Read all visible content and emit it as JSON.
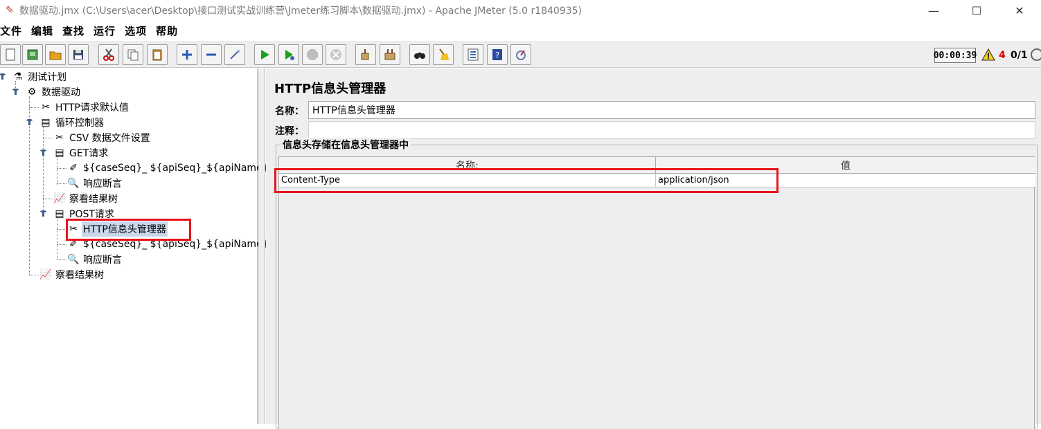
{
  "window": {
    "title": "数据驱动.jmx (C:\\Users\\acer\\Desktop\\接口测试实战训练营\\Jmeter练习脚本\\数据驱动.jmx) - Apache JMeter (5.0 r1840935)",
    "minimize": "—",
    "maximize": "☐",
    "close": "✕"
  },
  "menu": [
    "文件",
    "编辑",
    "查找",
    "运行",
    "选项",
    "帮助"
  ],
  "toolbar_status": {
    "timer": "00:00:39",
    "warnings": "4",
    "threads": "0/1"
  },
  "tree": {
    "test_plan": "测试计划",
    "thread_group": "数据驱动",
    "http_defaults": "HTTP请求默认值",
    "loop_controller": "循环控制器",
    "csv_config": "CSV 数据文件设置",
    "get_controller": "GET请求",
    "get_sampler": "${caseSeq}_ ${apiSeq}_${apiName}",
    "get_assertion": "响应断言",
    "result_tree_1": "察看结果树",
    "post_controller": "POST请求",
    "post_header_manager": "HTTP信息头管理器",
    "post_sampler": "${caseSeq}_ ${apiSeq}_${apiName}",
    "post_assertion": "响应断言",
    "result_tree_2": "察看结果树"
  },
  "panel": {
    "title": "HTTP信息头管理器",
    "name_label": "名称：",
    "name_value": "HTTP信息头管理器",
    "comment_label": "注释：",
    "comment_value": "",
    "group_title": "信息头存储在信息头管理器中",
    "columns": [
      "名称:",
      "值"
    ],
    "rows": [
      {
        "name": "Content-Type",
        "value": "application/json"
      }
    ]
  },
  "colors": {
    "highlight_box": "#e8141b",
    "selected_node": "#c8d8ea",
    "warning_count": "#e00000"
  }
}
